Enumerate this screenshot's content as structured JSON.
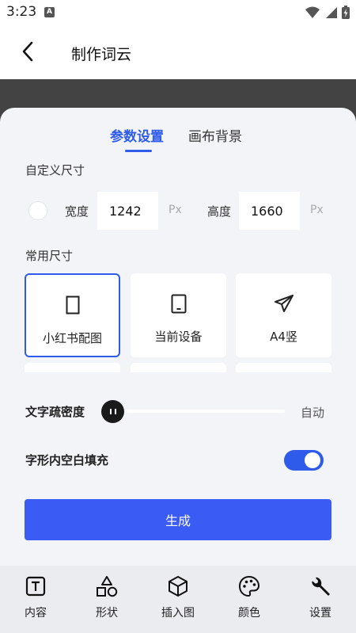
{
  "status_bar": {
    "time": "3:23",
    "notification_letter": "A"
  },
  "app_bar": {
    "title": "制作词云"
  },
  "tabs": [
    {
      "label": "参数设置",
      "active": true
    },
    {
      "label": "画布背景",
      "active": false
    }
  ],
  "custom_size": {
    "label": "自定义尺寸",
    "width_label": "宽度",
    "width_value": "1242",
    "height_label": "高度",
    "height_value": "1660",
    "unit": "Px"
  },
  "common_sizes": {
    "label": "常用尺寸",
    "items": [
      {
        "label": "小红书配图",
        "icon": "portrait-frame-icon",
        "selected": true
      },
      {
        "label": "当前设备",
        "icon": "phone-icon",
        "selected": false
      },
      {
        "label": "A4竖",
        "icon": "paper-plane-icon",
        "selected": false
      }
    ]
  },
  "density": {
    "label": "文字疏密度",
    "value": "自动",
    "level": 0
  },
  "fill_blank": {
    "label": "字形内空白填充",
    "enabled": true
  },
  "generate_label": "生成",
  "bottom_nav": [
    {
      "label": "内容",
      "icon": "text-box-icon"
    },
    {
      "label": "形状",
      "icon": "shapes-icon"
    },
    {
      "label": "插入图",
      "icon": "cube-icon"
    },
    {
      "label": "颜色",
      "icon": "palette-icon"
    },
    {
      "label": "设置",
      "icon": "wrench-icon"
    }
  ],
  "colors": {
    "accent": "#2f5bea",
    "button": "#3b5bf5",
    "sheet": "#f3f4f8",
    "preview": "#434343"
  }
}
